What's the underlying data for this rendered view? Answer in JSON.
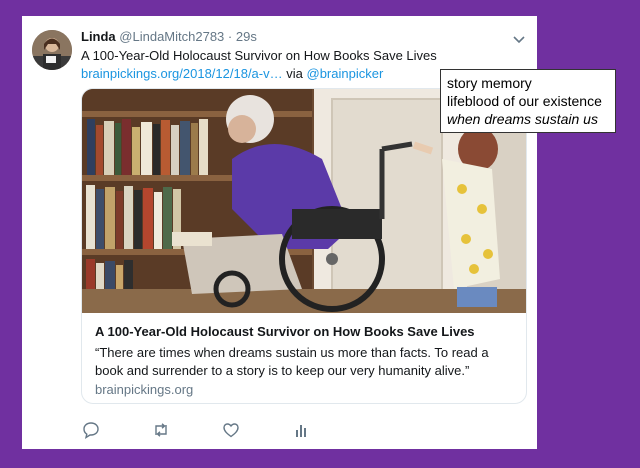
{
  "tweet": {
    "name": "Linda",
    "handle": "@LindaMitch2783",
    "separator": "·",
    "time": "29s",
    "text": "A 100-Year-Old Holocaust Survivor on How Books Save Lives",
    "link": "brainpickings.org/2018/12/18/a-v…",
    "via": "via",
    "mention": "@brainpicker"
  },
  "card": {
    "title": "A 100-Year-Old Holocaust Survivor on How Books Save Lives",
    "description": "“There are times when dreams sustain us more than facts. To read a book and surrender to a story is to keep our very humanity alive.”",
    "domain": "brainpickings.org"
  },
  "actions": [
    {
      "icon": "reply-icon"
    },
    {
      "icon": "retweet-icon"
    },
    {
      "icon": "like-icon"
    },
    {
      "icon": "analytics-icon"
    }
  ],
  "note": {
    "line1": "story memory",
    "line2": "lifeblood of our existence",
    "line3": "when dreams sustain us"
  },
  "colors": {
    "background": "#7030a0",
    "link": "#1b95e0",
    "muted": "#657786"
  }
}
